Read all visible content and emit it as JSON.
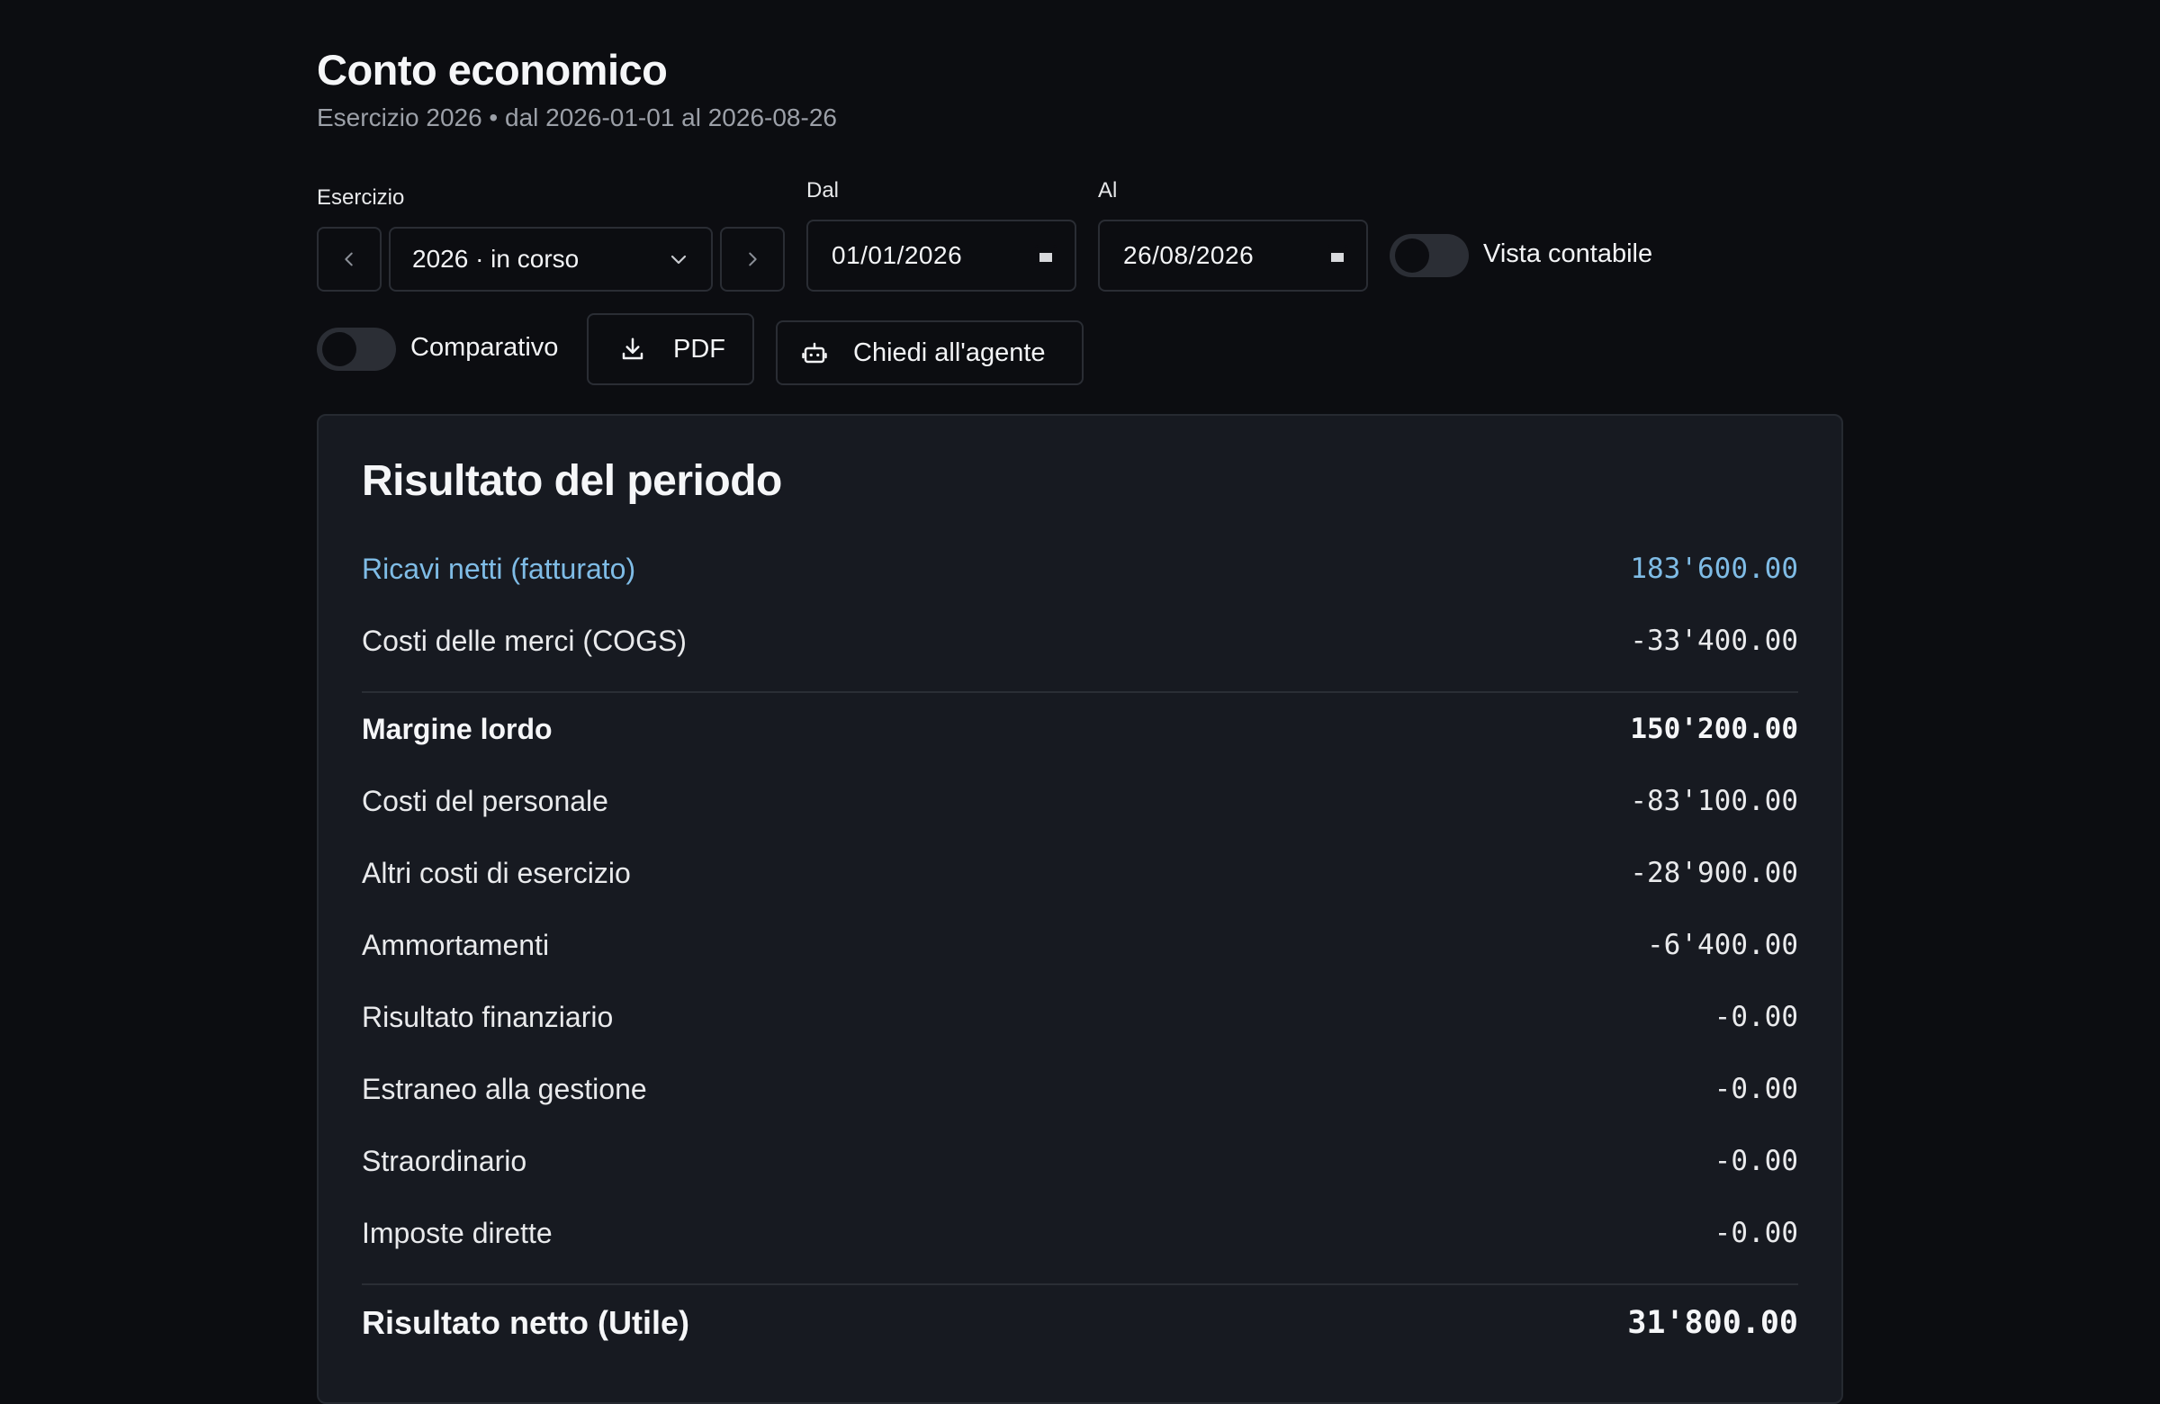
{
  "header": {
    "title": "Conto economico",
    "subtitle": "Esercizio 2026 • dal 2026-01-01 al 2026-08-26"
  },
  "filters": {
    "esercizio_label": "Esercizio",
    "esercizio_value": "2026 · in corso",
    "dal_label": "Dal",
    "dal_value": "01/01/2026",
    "al_label": "Al",
    "al_value": "26/08/2026",
    "vista_contabile_label": "Vista contabile",
    "vista_contabile_on": false
  },
  "actions": {
    "comparativo_label": "Comparativo",
    "comparativo_on": false,
    "pdf_label": "PDF",
    "agent_label": "Chiedi all'agente"
  },
  "result": {
    "title": "Risultato del periodo",
    "rows": [
      {
        "label": "Ricavi netti (fatturato)",
        "amount": "183'600.00"
      },
      {
        "label": "Costi delle merci (COGS)",
        "amount": "-33'400.00"
      },
      {
        "label": "Margine lordo",
        "amount": "150'200.00"
      },
      {
        "label": "Costi del personale",
        "amount": "-83'100.00"
      },
      {
        "label": "Altri costi di esercizio",
        "amount": "-28'900.00"
      },
      {
        "label": "Ammortamenti",
        "amount": "-6'400.00"
      },
      {
        "label": "Risultato finanziario",
        "amount": "-0.00"
      },
      {
        "label": "Estraneo alla gestione",
        "amount": "-0.00"
      },
      {
        "label": "Straordinario",
        "amount": "-0.00"
      },
      {
        "label": "Imposte dirette",
        "amount": "-0.00"
      },
      {
        "label": "Risultato netto (Utile)",
        "amount": "31'800.00"
      }
    ]
  },
  "colors": {
    "background": "#0c0d11",
    "card": "#171a21",
    "accent": "#7fbce6"
  }
}
